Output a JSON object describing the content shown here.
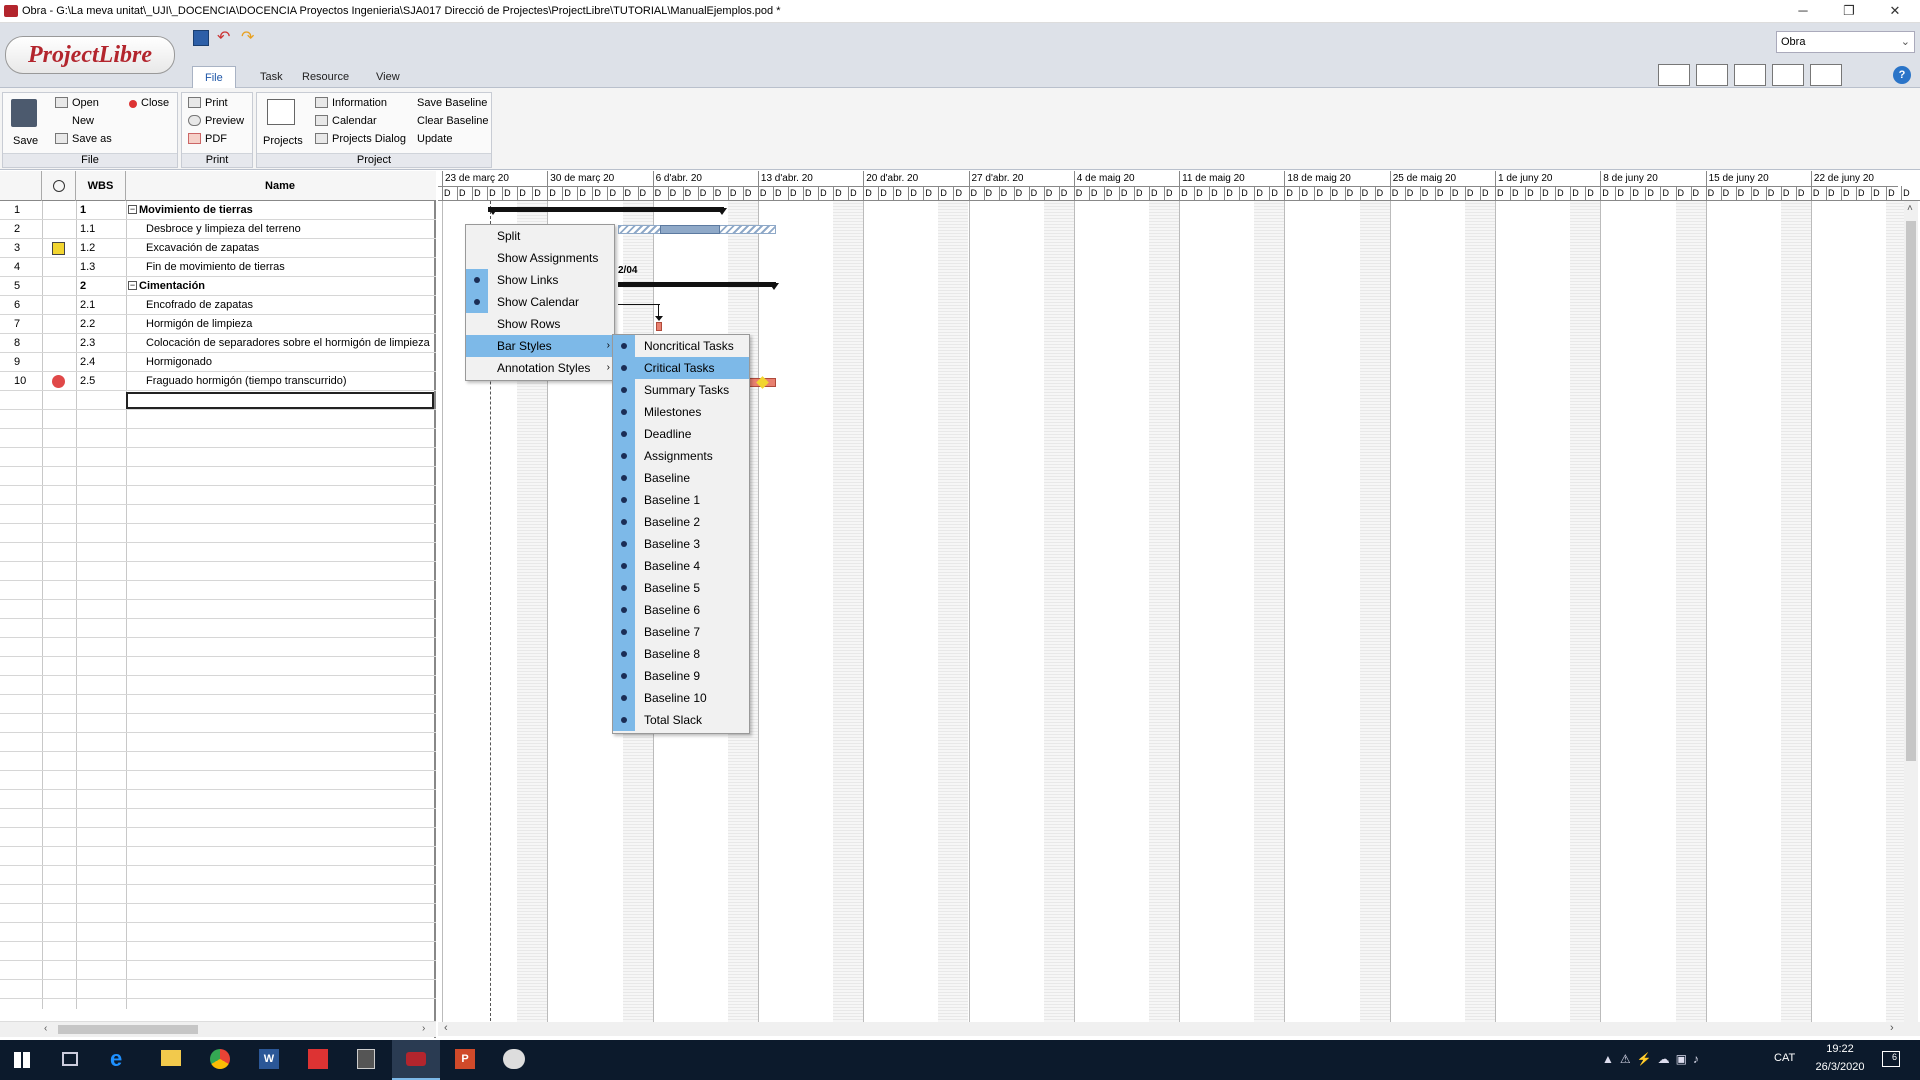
{
  "titlebar": {
    "title": "Obra - G:\\La meva unitat\\_UJI\\_DOCENCIA\\DOCENCIA Proyectos Ingenieria\\SJA017 Direcció de Projectes\\ProjectLibre\\TUTORIAL\\ManualEjemplos.pod *",
    "minimize": "─",
    "restore": "❐",
    "close": "✕"
  },
  "app": {
    "logo": "ProjectLibre",
    "project_selector": "Obra"
  },
  "tabs": [
    "File",
    "Task",
    "Resource",
    "View"
  ],
  "ribbon": {
    "file": {
      "save": "Save",
      "open": "Open",
      "new": "New",
      "save_as": "Save as",
      "close": "Close",
      "group": "File"
    },
    "print": {
      "print": "Print",
      "preview": "Preview",
      "pdf": "PDF",
      "group": "Print"
    },
    "project": {
      "projects": "Projects",
      "information": "Information",
      "calendar": "Calendar",
      "projects_dialog": "Projects Dialog",
      "save_baseline": "Save Baseline",
      "clear_baseline": "Clear Baseline",
      "update": "Update",
      "group": "Project"
    }
  },
  "table": {
    "headers": {
      "wbs": "WBS",
      "name": "Name"
    },
    "rows": [
      {
        "id": "1",
        "wbs": "1",
        "name": "Movimiento de tierras",
        "summary": true,
        "indicator": ""
      },
      {
        "id": "2",
        "wbs": "1.1",
        "name": "Desbroce y limpieza del terreno",
        "summary": false,
        "indicator": ""
      },
      {
        "id": "3",
        "wbs": "1.2",
        "name": "Excavación de zapatas",
        "summary": false,
        "indicator": "calendar-icon"
      },
      {
        "id": "4",
        "wbs": "1.3",
        "name": "Fin de movimiento de tierras",
        "summary": false,
        "indicator": ""
      },
      {
        "id": "5",
        "wbs": "2",
        "name": "Cimentación",
        "summary": true,
        "indicator": ""
      },
      {
        "id": "6",
        "wbs": "2.1",
        "name": "Encofrado de zapatas",
        "summary": false,
        "indicator": ""
      },
      {
        "id": "7",
        "wbs": "2.2",
        "name": "Hormigón de limpieza",
        "summary": false,
        "indicator": ""
      },
      {
        "id": "8",
        "wbs": "2.3",
        "name": "Colocación de separadores sobre el hormigón de limpieza",
        "summary": false,
        "indicator": ""
      },
      {
        "id": "9",
        "wbs": "2.4",
        "name": "Hormigonado",
        "summary": false,
        "indicator": ""
      },
      {
        "id": "10",
        "wbs": "2.5",
        "name": "Fraguado hormigón (tiempo transcurrido)",
        "summary": false,
        "indicator": "error-icon"
      }
    ]
  },
  "gantt": {
    "weeks": [
      "23 de març 20",
      "30 de març 20",
      "6 d'abr. 20",
      "13 d'abr. 20",
      "20 d'abr. 20",
      "27 d'abr. 20",
      "4 de maig 20",
      "11 de maig 20",
      "18 de maig 20",
      "25 de maig 20",
      "1 de juny 20",
      "8 de juny 20",
      "15 de juny 20",
      "22 de juny 20"
    ],
    "day_letter": "D",
    "annotation": "2/04"
  },
  "context_menu": {
    "items": [
      {
        "label": "Split",
        "checked": false
      },
      {
        "label": "Show Assignments",
        "checked": false
      },
      {
        "label": "Show Links",
        "checked": true
      },
      {
        "label": "Show Calendar",
        "checked": true
      },
      {
        "label": "Show Rows",
        "checked": false
      },
      {
        "label": "Bar Styles",
        "checked": false,
        "submenu": true
      },
      {
        "label": "Annotation Styles",
        "checked": false,
        "submenu": true
      }
    ]
  },
  "bar_styles_menu": {
    "items": [
      "Noncritical Tasks",
      "Critical Tasks",
      "Summary Tasks",
      "Milestones",
      "Deadline",
      "Assignments",
      "Baseline",
      "Baseline 1",
      "Baseline 2",
      "Baseline 3",
      "Baseline 4",
      "Baseline 5",
      "Baseline 6",
      "Baseline 7",
      "Baseline 8",
      "Baseline 9",
      "Baseline 10",
      "Total Slack"
    ],
    "highlighted": "Critical Tasks"
  },
  "taskbar": {
    "language": "CAT",
    "time": "19:22",
    "date": "26/3/2020",
    "notifications": "6"
  },
  "colors": {
    "accent": "#1f57a8",
    "menu_highlight": "#7db9e8",
    "critical_bar": "#e88070",
    "noncritical_bar": "#8fa9c8",
    "taskbar": "#0c1a2c"
  }
}
